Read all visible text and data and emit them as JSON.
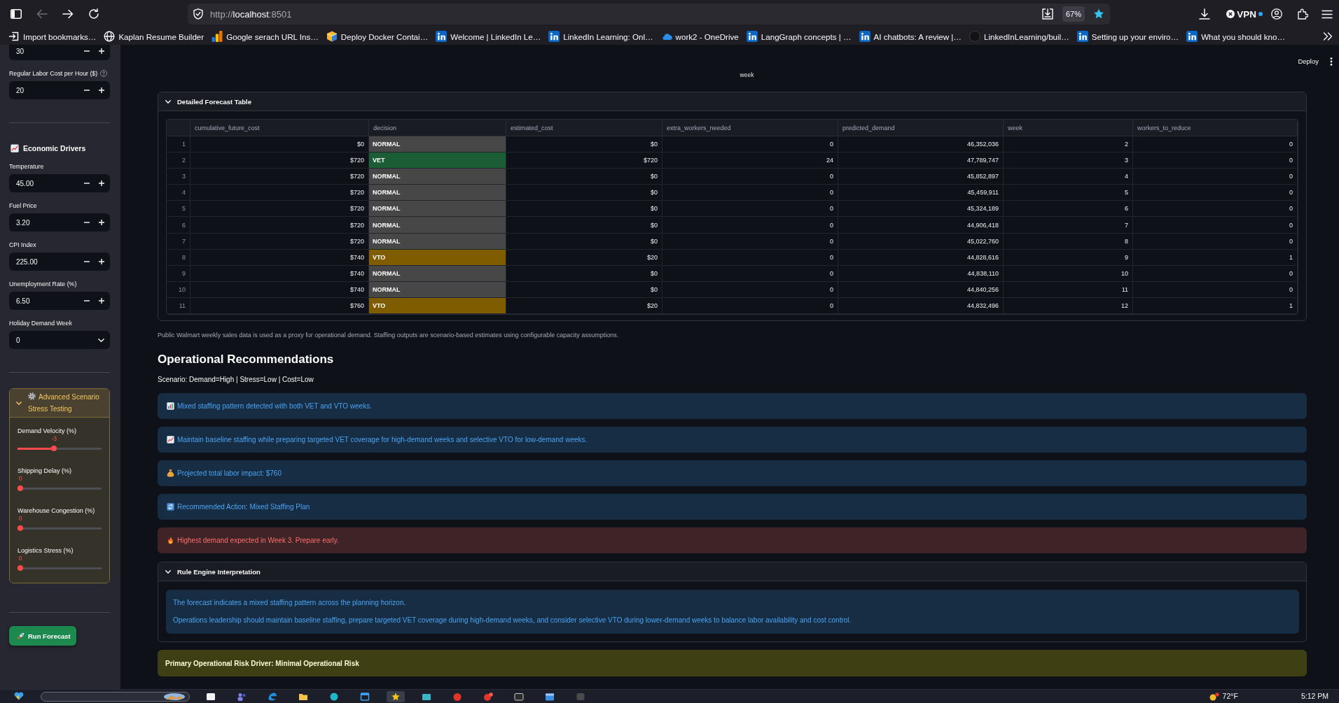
{
  "browser": {
    "back_disabled": true,
    "forward_disabled": false,
    "url": {
      "scheme": "http://",
      "host": "localhost",
      "port": ":8501"
    },
    "zoom": "67%",
    "bookmarked": true,
    "vpn": "VPN",
    "bookmarks": [
      "Import bookmarks…",
      "Kaplan Resume Builder",
      "Google serach URL Ins…",
      "Deploy Docker Contai…",
      "Welcome | LinkedIn Le…",
      "LinkedIn Learning: Onl…",
      "work2 - OneDrive",
      "LangGraph concepts | …",
      "AI chatbots: A review |…",
      "LinkedInLearning/buil…",
      "Setting up your enviro…",
      "What you should kno…"
    ]
  },
  "sidebar": {
    "items": [
      {
        "kind": "number",
        "value": "30",
        "help": false
      },
      {
        "kind": "number",
        "label": "Regular Labor Cost per Hour ($)",
        "value": "20",
        "help": true
      },
      {
        "kind": "divider"
      },
      {
        "kind": "heading",
        "text": "Economic Drivers"
      },
      {
        "kind": "number",
        "label": "Temperature",
        "value": "45.00",
        "help": false
      },
      {
        "kind": "number",
        "label": "Fuel Price",
        "value": "3.20",
        "help": false
      },
      {
        "kind": "number",
        "label": "CPI Index",
        "value": "225.00",
        "help": false
      },
      {
        "kind": "number",
        "label": "Unemployment Rate (%)",
        "value": "6.50",
        "help": false
      },
      {
        "kind": "select",
        "label": "Holiday Demand Week",
        "value": "0"
      },
      {
        "kind": "divider"
      },
      {
        "kind": "expander",
        "title": "Advanced Scenario Stress Testing",
        "expanded": true,
        "sliders": [
          {
            "label": "Demand Velocity (%)",
            "reading": "-3",
            "level": 0.43
          },
          {
            "label": "Shipping Delay (%)",
            "reading": "0",
            "level": 0
          },
          {
            "label": "Warehouse Congestion (%)",
            "reading": "0",
            "level": 0
          },
          {
            "label": "Logistics Stress (%)",
            "reading": "0",
            "level": 0
          }
        ]
      },
      {
        "kind": "divider"
      },
      {
        "kind": "button",
        "label": "Run Forecast"
      }
    ]
  },
  "header": {
    "deploy": "Deploy"
  },
  "chart_axis_label": "week",
  "forecast_table": {
    "title": "Detailed Forecast Table",
    "expanded": true,
    "columns": [
      {
        "label": "cumulative_future_cost",
        "kind": "number"
      },
      {
        "label": "decision",
        "kind": "tag"
      },
      {
        "label": "estimated_cost",
        "kind": "number"
      },
      {
        "label": "extra_workers_needed",
        "kind": "number"
      },
      {
        "label": "predicted_demand",
        "kind": "number"
      },
      {
        "label": "week",
        "kind": "number"
      },
      {
        "label": "workers_to_reduce",
        "kind": "number"
      }
    ],
    "rows": [
      {
        "index": "1",
        "cells": [
          "$0",
          "NORMAL",
          "$0",
          "0",
          "46,352,036",
          "2",
          "0"
        ],
        "color": "#474747"
      },
      {
        "index": "2",
        "cells": [
          "$720",
          "VET",
          "$720",
          "24",
          "47,789,747",
          "3",
          "0"
        ],
        "color": "#1b5e35"
      },
      {
        "index": "3",
        "cells": [
          "$720",
          "NORMAL",
          "$0",
          "0",
          "45,852,897",
          "4",
          "0"
        ],
        "color": "#474747"
      },
      {
        "index": "4",
        "cells": [
          "$720",
          "NORMAL",
          "$0",
          "0",
          "45,459,911",
          "5",
          "0"
        ],
        "color": "#474747"
      },
      {
        "index": "5",
        "cells": [
          "$720",
          "NORMAL",
          "$0",
          "0",
          "45,324,189",
          "6",
          "0"
        ],
        "color": "#474747"
      },
      {
        "index": "6",
        "cells": [
          "$720",
          "NORMAL",
          "$0",
          "0",
          "44,906,418",
          "7",
          "0"
        ],
        "color": "#474747"
      },
      {
        "index": "7",
        "cells": [
          "$720",
          "NORMAL",
          "$0",
          "0",
          "45,022,760",
          "8",
          "0"
        ],
        "color": "#474747"
      },
      {
        "index": "8",
        "cells": [
          "$740",
          "VTO",
          "$20",
          "0",
          "44,828,616",
          "9",
          "1"
        ],
        "color": "#7f5c00"
      },
      {
        "index": "9",
        "cells": [
          "$740",
          "NORMAL",
          "$0",
          "0",
          "44,838,110",
          "10",
          "0"
        ],
        "color": "#474747"
      },
      {
        "index": "10",
        "cells": [
          "$740",
          "NORMAL",
          "$0",
          "0",
          "44,840,256",
          "11",
          "0"
        ],
        "color": "#474747"
      },
      {
        "index": "11",
        "cells": [
          "$760",
          "VTO",
          "$20",
          "0",
          "44,832,496",
          "12",
          "1"
        ],
        "color": "#7f5c00"
      }
    ]
  },
  "caption": "Public Walmart weekly sales data is used as a proxy for operational demand. Staffing outputs are scenario-based estimates using configurable capacity assumptions.",
  "recommendations": {
    "title": "Operational Recommendations",
    "scenario": "Scenario: Demand=High | Stress=Low | Cost=Low",
    "alerts": [
      {
        "kind": "info",
        "text": "Mixed staffing pattern detected with both VET and VTO weeks."
      },
      {
        "kind": "info",
        "text": "Maintain baseline staffing while preparing targeted VET coverage for high-demand weeks and selective VTO for low-demand weeks."
      },
      {
        "kind": "info",
        "text": "Projected total labor impact: $760"
      },
      {
        "kind": "info",
        "text": "Recommended Action: Mixed Staffing Plan"
      },
      {
        "kind": "error",
        "text": "Highest demand expected in Week 3. Prepare early."
      }
    ]
  },
  "rule_engine": {
    "title": "Rule Engine Interpretation",
    "expanded": true,
    "paragraphs": [
      "The forecast indicates a mixed staffing pattern across the planning horizon.",
      "Operations leadership should maintain baseline staffing, prepare targeted VET coverage during high-demand weeks, and consider selective VTO during lower-demand weeks to balance labor availability and cost control."
    ]
  },
  "risk_banner": {
    "kind": "warning",
    "text": "Primary Operational Risk Driver: Minimal Operational Risk"
  },
  "taskbar": {
    "apps": [
      {
        "selected": false
      },
      {
        "selected": false
      },
      {
        "selected": false
      },
      {
        "selected": false
      },
      {
        "selected": false
      },
      {
        "selected": false
      },
      {
        "selected": true
      },
      {
        "selected": false
      },
      {
        "selected": false
      },
      {
        "selected": false
      },
      {
        "selected": false
      },
      {
        "selected": false
      },
      {
        "selected": false
      }
    ],
    "weather": "72°F",
    "clock": "5:12 PM"
  }
}
